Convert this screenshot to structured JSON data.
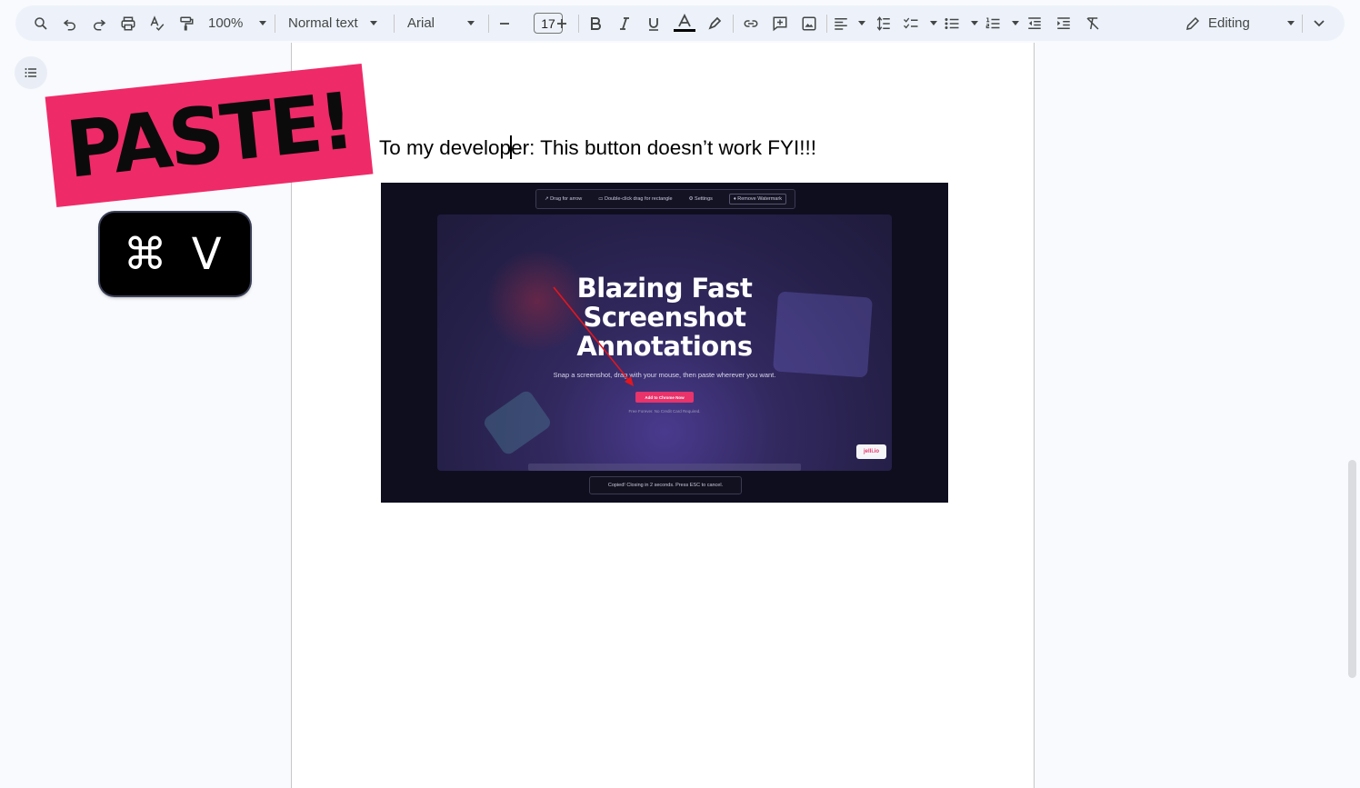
{
  "toolbar": {
    "zoom": "100%",
    "style": "Normal text",
    "font": "Arial",
    "font_size": "17",
    "mode": "Editing",
    "icons": [
      "search-icon",
      "undo-icon",
      "redo-icon",
      "print-icon",
      "spellcheck-icon",
      "paint-format-icon",
      "decrease-size-icon",
      "increase-size-icon",
      "bold-icon",
      "italic-icon",
      "underline-icon",
      "text-color-icon",
      "highlight-icon",
      "link-icon",
      "comment-icon",
      "image-icon",
      "align-icon",
      "line-spacing-icon",
      "checklist-icon",
      "bullet-list-icon",
      "numbered-list-icon",
      "decrease-indent-icon",
      "increase-indent-icon",
      "clear-formatting-icon",
      "pencil-icon",
      "collapse-icon"
    ],
    "text_color": "#000000"
  },
  "document": {
    "line_before_cursor": "To my develop",
    "line_after_cursor": "er: This button doesn’t work FYI!!!"
  },
  "overlay": {
    "paste_label": "PASTE!",
    "shortcut": "⌘ V",
    "paste_color": "#ef2a68"
  },
  "screenshot": {
    "toolbar_items": [
      "Drag for arrow",
      "Double-click drag for rectangle",
      "Settings",
      "Remove Watermark"
    ],
    "title_lines": [
      "Blazing Fast",
      "Screenshot",
      "Annotations"
    ],
    "subtitle": "Snap a screenshot, drag with your mouse, then paste wherever you want.",
    "cta": "Add to Chrome Now",
    "note": "Free Forever. No Credit Card Required.",
    "badge": "jelli.io",
    "toast": "Copied! Closing in 2 seconds. Press ESC to cancel.",
    "accent": "#e8336b"
  }
}
